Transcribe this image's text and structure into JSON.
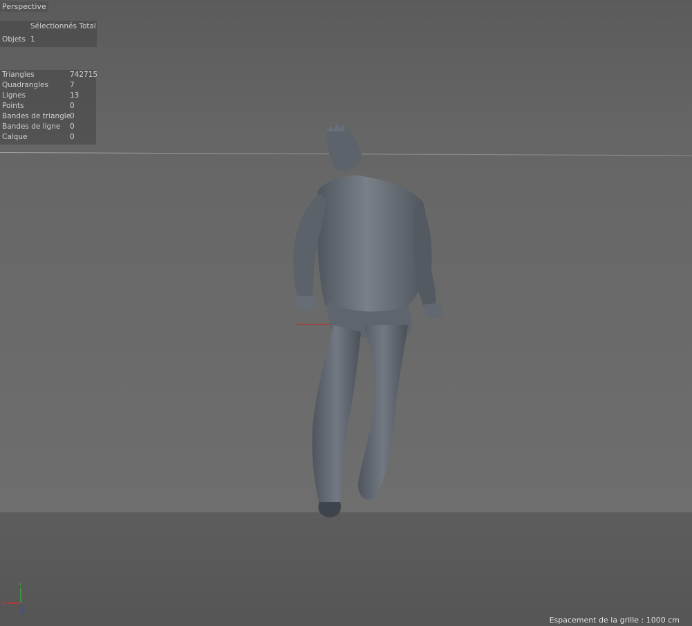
{
  "viewport": {
    "camera_label": "Perspective",
    "grid_spacing": "Espacement de la grille : 1000 cm"
  },
  "object_info": {
    "header": "Sélectionnés Total",
    "rows": [
      {
        "label": "Objets",
        "value": "1"
      }
    ]
  },
  "stats": [
    {
      "label": "Triangles",
      "value": "742715"
    },
    {
      "label": "Quadrangles",
      "value": "7"
    },
    {
      "label": "Lignes",
      "value": "13"
    },
    {
      "label": "Points",
      "value": "0"
    },
    {
      "label": "Bandes de triangle",
      "value": "0"
    },
    {
      "label": "Bandes de ligne",
      "value": "0"
    },
    {
      "label": "Calque",
      "value": "0"
    }
  ],
  "axis_gizmo": {
    "y": "Y",
    "x": "X",
    "z": "Z"
  },
  "colors": {
    "x_axis": "#cc3333",
    "y_axis": "#33aa33",
    "z_axis": "#3344cc",
    "model": "#6a7078"
  }
}
